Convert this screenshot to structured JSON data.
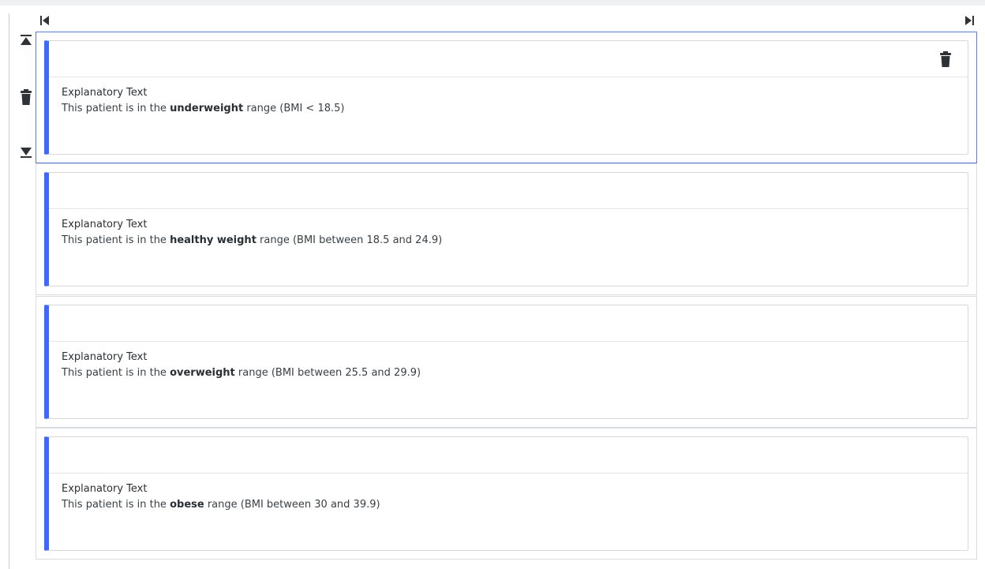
{
  "icons": {
    "first": "skip-to-start-icon",
    "last": "skip-to-end-icon",
    "move_up": "move-to-top-icon",
    "delete": "trash-icon",
    "move_down": "move-to-bottom-icon"
  },
  "colors": {
    "accent": "#3e67ff",
    "selected_border": "#5b7fd6",
    "icon": "#2f3338"
  },
  "entries": [
    {
      "label": "Explanatory Text",
      "prefix": "This patient is in the",
      "emphasis": "underweight",
      "suffix": "range (BMI < 18.5)",
      "selected": true
    },
    {
      "label": "Explanatory Text",
      "prefix": "This patient is in the",
      "emphasis": "healthy weight",
      "suffix": "range (BMI between 18.5 and 24.9)",
      "selected": false
    },
    {
      "label": "Explanatory Text",
      "prefix": "This patient is in the",
      "emphasis": "overweight",
      "suffix": "range (BMI between 25.5 and 29.9)",
      "selected": false
    },
    {
      "label": "Explanatory Text",
      "prefix": "This patient is in the",
      "emphasis": "obese",
      "suffix": "range (BMI between 30 and 39.9)",
      "selected": false
    }
  ]
}
